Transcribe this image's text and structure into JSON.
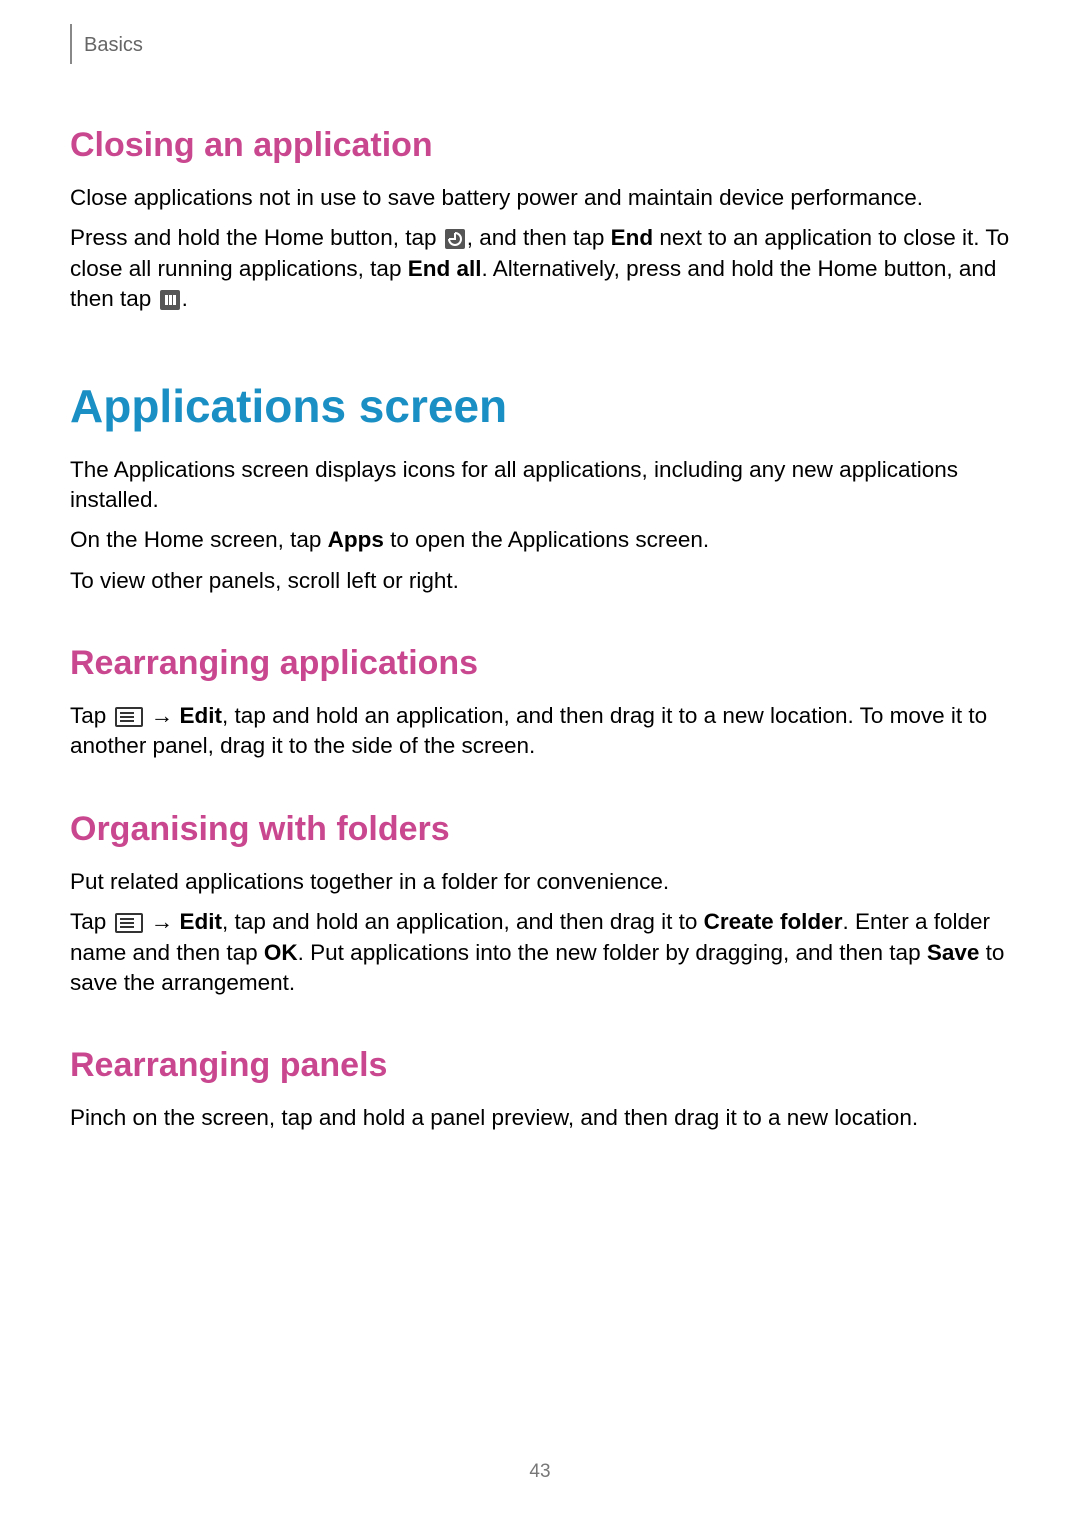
{
  "breadcrumb": "Basics",
  "page_number": "43",
  "sections": {
    "closing": {
      "heading": "Closing an application",
      "p1": "Close applications not in use to save battery power and maintain device performance.",
      "p2_pre": "Press and hold the Home button, tap ",
      "p2_after_icon1": ", and then tap ",
      "p2_bold1": "End",
      "p2_mid": " next to an application to close it. To close all running applications, tap ",
      "p2_bold2": "End all",
      "p2_after_bold2": ". Alternatively, press and hold the Home button, and then tap ",
      "p2_end": "."
    },
    "apps_screen": {
      "heading": "Applications screen",
      "p1": "The Applications screen displays icons for all applications, including any new applications installed.",
      "p2_pre": "On the Home screen, tap ",
      "p2_bold": "Apps",
      "p2_post": " to open the Applications screen.",
      "p3": "To view other panels, scroll left or right."
    },
    "rearranging_apps": {
      "heading": "Rearranging applications",
      "p1_pre": "Tap ",
      "p1_arrow": " → ",
      "p1_bold": "Edit",
      "p1_post": ", tap and hold an application, and then drag it to a new location. To move it to another panel, drag it to the side of the screen."
    },
    "organising": {
      "heading": "Organising with folders",
      "p1": "Put related applications together in a folder for convenience.",
      "p2_pre": "Tap ",
      "p2_arrow": " → ",
      "p2_bold1": "Edit",
      "p2_mid1": ", tap and hold an application, and then drag it to ",
      "p2_bold2": "Create folder",
      "p2_mid2": ". Enter a folder name and then tap ",
      "p2_bold3": "OK",
      "p2_mid3": ". Put applications into the new folder by dragging, and then tap ",
      "p2_bold4": "Save",
      "p2_end": " to save the arrangement."
    },
    "rearranging_panels": {
      "heading": "Rearranging panels",
      "p1": "Pinch on the screen, tap and hold a panel preview, and then drag it to a new location."
    }
  }
}
